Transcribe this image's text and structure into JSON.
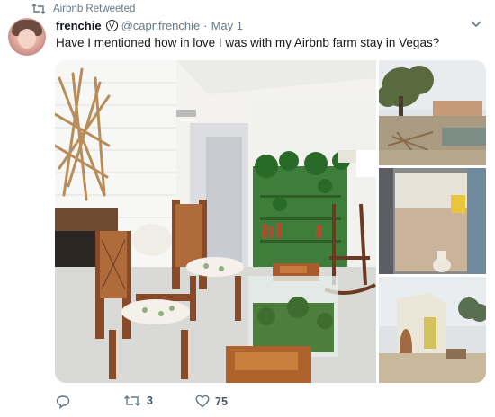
{
  "retweet_banner": {
    "text": "Airbnb Retweeted",
    "icon": "retweet-icon"
  },
  "tweet": {
    "author_name": "frenchie",
    "verified_glyph": "V",
    "handle": "@capnfrenchie",
    "separator": "·",
    "date": "May 1",
    "text": "Have I mentioned how in love I was with my Airbnb farm stay in Vegas?",
    "menu_icon": "chevron-down-icon"
  },
  "media": {
    "main": "living-room-photo",
    "thumbs": [
      "desert-garden-photo",
      "doorway-view-photo",
      "tiny-house-photo"
    ]
  },
  "actions": {
    "reply": {
      "icon": "reply-icon",
      "count": ""
    },
    "retweet": {
      "icon": "retweet-icon",
      "count": "3"
    },
    "like": {
      "icon": "heart-icon",
      "count": "75"
    }
  },
  "colors": {
    "text": "#14171a",
    "muted": "#657786"
  }
}
